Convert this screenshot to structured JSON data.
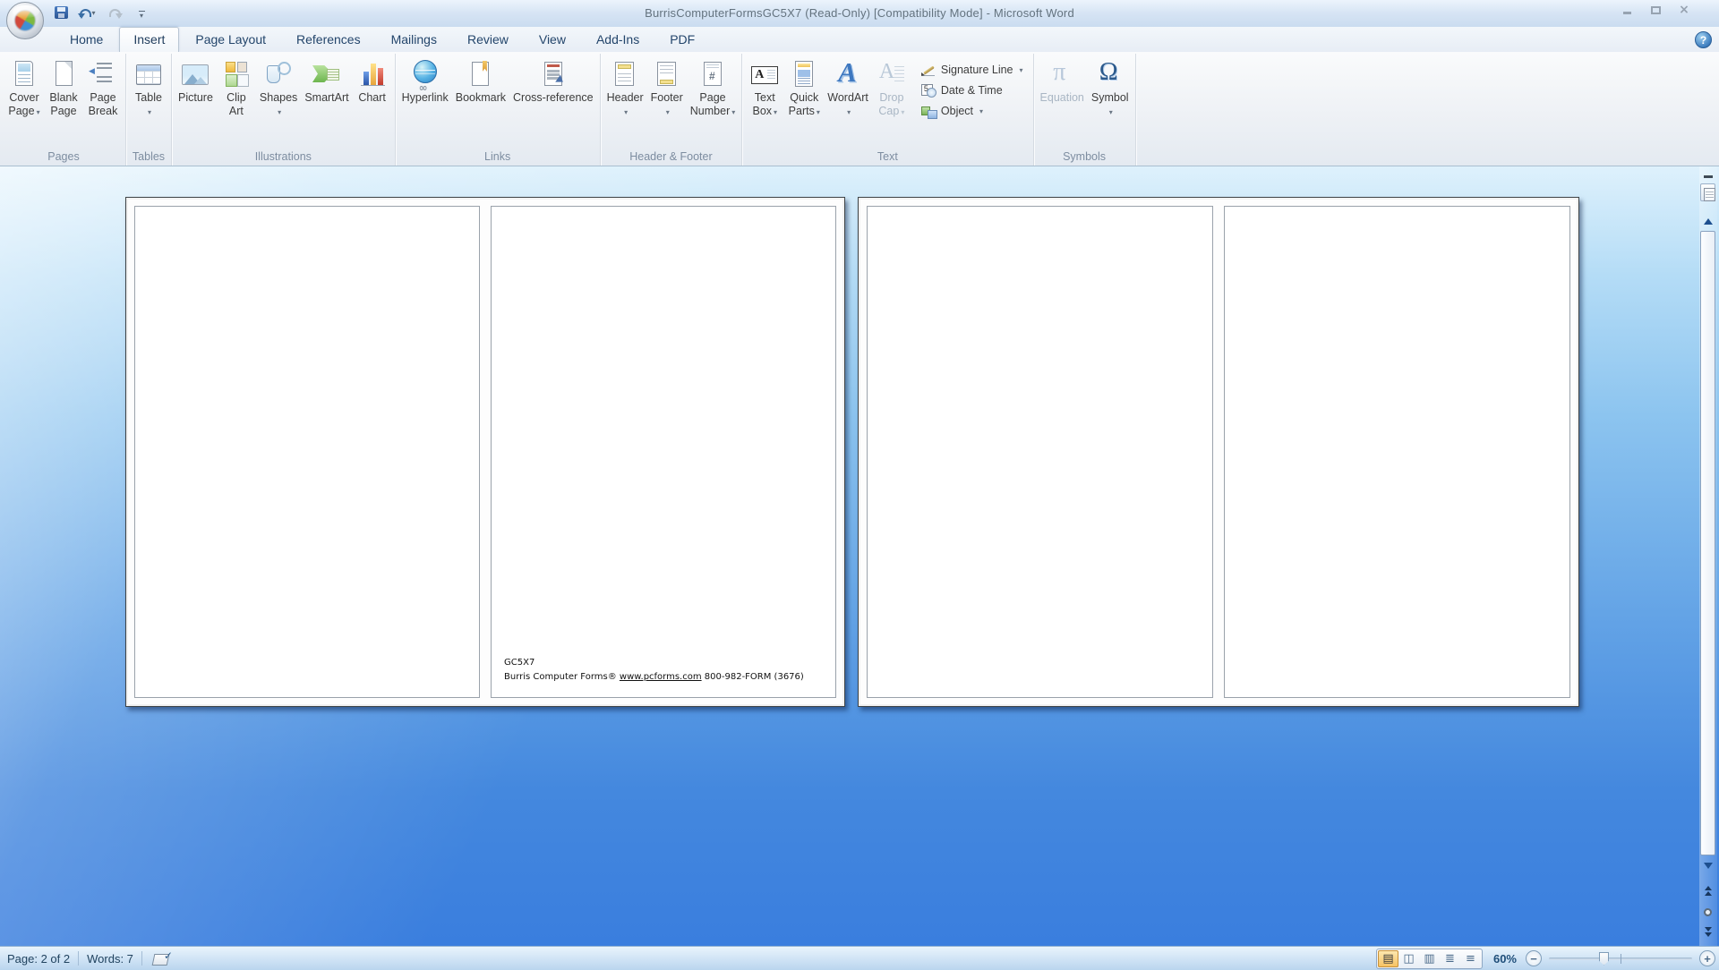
{
  "window": {
    "title": "BurrisComputerFormsGC5X7 (Read-Only) [Compatibility Mode] - Microsoft Word"
  },
  "tabs": [
    {
      "label": "Home",
      "active": false
    },
    {
      "label": "Insert",
      "active": true
    },
    {
      "label": "Page Layout",
      "active": false
    },
    {
      "label": "References",
      "active": false
    },
    {
      "label": "Mailings",
      "active": false
    },
    {
      "label": "Review",
      "active": false
    },
    {
      "label": "View",
      "active": false
    },
    {
      "label": "Add-Ins",
      "active": false
    },
    {
      "label": "PDF",
      "active": false
    }
  ],
  "ribbon": {
    "groups": [
      {
        "label": "Pages",
        "buttons": [
          {
            "lines": [
              "Cover",
              "Page"
            ],
            "icon": "cover-page",
            "arrow": true
          },
          {
            "lines": [
              "Blank",
              "Page"
            ],
            "icon": "blank-page"
          },
          {
            "lines": [
              "Page",
              "Break"
            ],
            "icon": "page-break"
          }
        ]
      },
      {
        "label": "Tables",
        "buttons": [
          {
            "lines": [
              "Table"
            ],
            "icon": "table",
            "arrow": true
          }
        ]
      },
      {
        "label": "Illustrations",
        "buttons": [
          {
            "lines": [
              "Picture"
            ],
            "icon": "picture"
          },
          {
            "lines": [
              "Clip",
              "Art"
            ],
            "icon": "clip-art"
          },
          {
            "lines": [
              "Shapes"
            ],
            "icon": "shapes",
            "arrow": true
          },
          {
            "lines": [
              "SmartArt"
            ],
            "icon": "smartart"
          },
          {
            "lines": [
              "Chart"
            ],
            "icon": "chart"
          }
        ]
      },
      {
        "label": "Links",
        "buttons": [
          {
            "lines": [
              "Hyperlink"
            ],
            "icon": "hyperlink"
          },
          {
            "lines": [
              "Bookmark"
            ],
            "icon": "bookmark"
          },
          {
            "lines": [
              "Cross-reference"
            ],
            "icon": "cross-reference"
          }
        ]
      },
      {
        "label": "Header & Footer",
        "buttons": [
          {
            "lines": [
              "Header"
            ],
            "icon": "header",
            "arrow": true
          },
          {
            "lines": [
              "Footer"
            ],
            "icon": "footer",
            "arrow": true
          },
          {
            "lines": [
              "Page",
              "Number"
            ],
            "icon": "page-number",
            "arrow": true
          }
        ]
      },
      {
        "label": "Text",
        "buttons": [
          {
            "lines": [
              "Text",
              "Box"
            ],
            "icon": "text-box",
            "arrow": true
          },
          {
            "lines": [
              "Quick",
              "Parts"
            ],
            "icon": "quick-parts",
            "arrow": true
          },
          {
            "lines": [
              "WordArt"
            ],
            "icon": "wordart",
            "arrow": true
          },
          {
            "lines": [
              "Drop",
              "Cap"
            ],
            "icon": "drop-cap",
            "arrow": true,
            "disabled": true
          }
        ],
        "small_buttons": [
          {
            "label": "Signature Line",
            "icon": "signature-line",
            "arrow": true
          },
          {
            "label": "Date & Time",
            "icon": "date-time"
          },
          {
            "label": "Object",
            "icon": "object",
            "arrow": true
          }
        ]
      },
      {
        "label": "Symbols",
        "buttons": [
          {
            "lines": [
              "Equation"
            ],
            "icon": "equation",
            "disabled": true
          },
          {
            "lines": [
              "Symbol"
            ],
            "icon": "symbol",
            "arrow": true
          }
        ]
      }
    ]
  },
  "document": {
    "card": {
      "line1": "GC5X7",
      "line2_prefix": "Burris Computer Forms® ",
      "line2_link": "www.pcforms.com",
      "line2_suffix": " 800-982-FORM (3676)"
    }
  },
  "statusbar": {
    "page": "Page: 2 of 2",
    "words": "Words: 7",
    "zoom": "60%",
    "view_buttons": [
      {
        "name": "print-layout",
        "active": true
      },
      {
        "name": "full-screen-reading",
        "active": false
      },
      {
        "name": "web-layout",
        "active": false
      },
      {
        "name": "outline",
        "active": false
      },
      {
        "name": "draft",
        "active": false
      }
    ]
  },
  "icons": {
    "office-button": "office-orb",
    "save": "floppy-disk",
    "undo": "curved-arrow-left",
    "redo": "curved-arrow-right",
    "help": "question-mark-circle",
    "proofing": "book-with-check"
  },
  "colors": {
    "doc_bg_top": "#def1fc",
    "doc_bg_bottom": "#3a7ede",
    "active_tab_border": "#b9c6d4",
    "zoom_text": "#1f4e79"
  }
}
